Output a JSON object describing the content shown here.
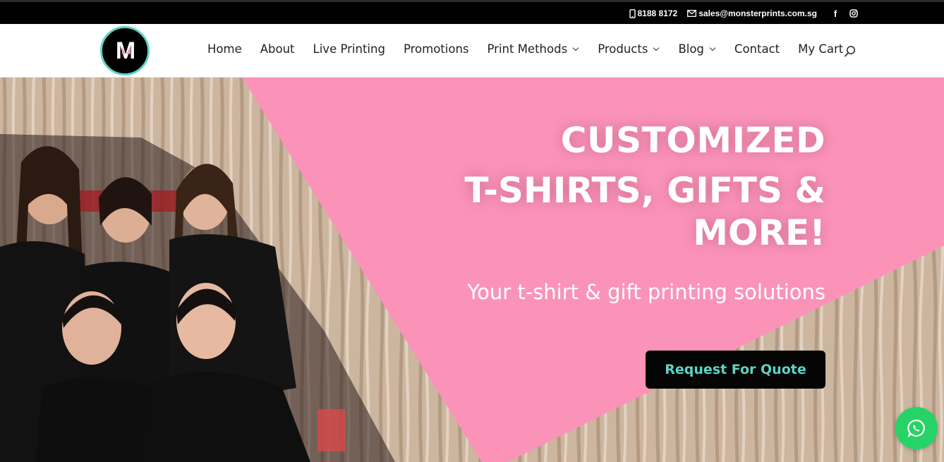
{
  "topbar": {
    "phone": "8188 8172",
    "email": "sales@monsterprints.com.sg",
    "social": [
      "facebook-icon",
      "instagram-icon"
    ]
  },
  "logo": {
    "letter": "M"
  },
  "menu": {
    "items": [
      {
        "label": "Home",
        "dropdown": false
      },
      {
        "label": "About",
        "dropdown": false
      },
      {
        "label": "Live Printing",
        "dropdown": false
      },
      {
        "label": "Promotions",
        "dropdown": false
      },
      {
        "label": "Print Methods",
        "dropdown": true
      },
      {
        "label": "Products",
        "dropdown": true
      },
      {
        "label": "Blog",
        "dropdown": true
      },
      {
        "label": "Contact",
        "dropdown": false
      },
      {
        "label": "My Cart",
        "dropdown": false
      }
    ]
  },
  "hero": {
    "title_line1": "CUSTOMIZED",
    "title_line2": "T-SHIRTS, GIFTS & MORE!",
    "subtitle": "Your t-shirt & gift printing solutions",
    "cta_label": "Request For Quote"
  },
  "colors": {
    "accent_teal": "#5fd3c4",
    "hero_pink": "#fb93b9",
    "hero_grey": "#c7cfd0",
    "whatsapp_green": "#25d366"
  }
}
